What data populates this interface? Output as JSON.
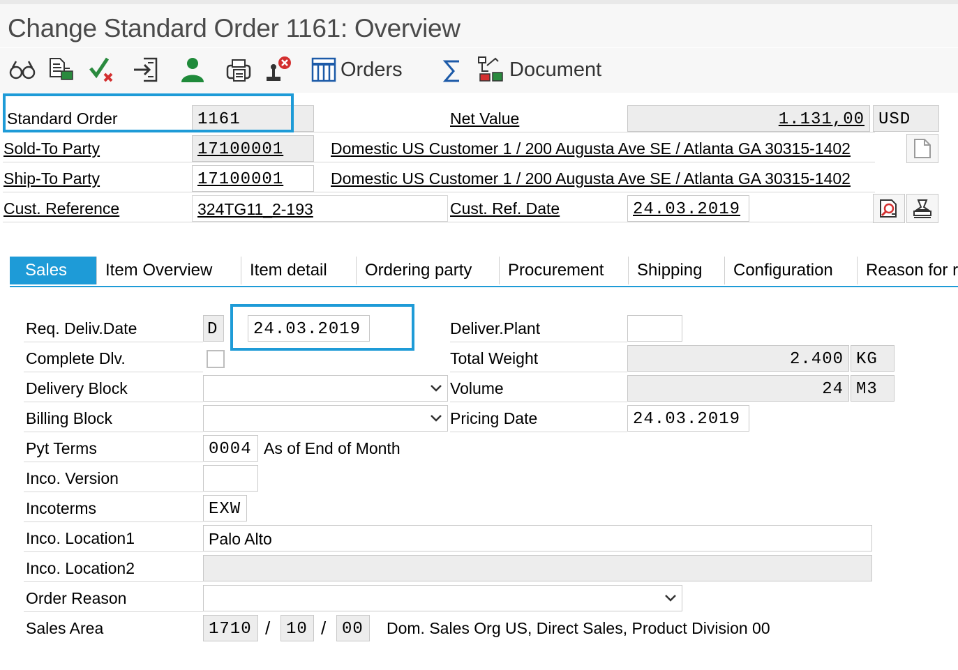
{
  "window": {
    "title": "Change Standard Order 1161: Overview"
  },
  "toolbar": {
    "icons": [
      "display-icon",
      "document-copy-icon",
      "check-icon",
      "exit-icon",
      "user-icon",
      "print-icon",
      "stop-icon",
      "grid-icon",
      "sum-icon",
      "document-tree-icon"
    ],
    "orders_label": "Orders",
    "document_label": "Document"
  },
  "header": {
    "standard_order_label": "Standard Order",
    "standard_order_value": "1161",
    "net_value_label": "Net Value",
    "net_value": "1.131,00",
    "currency": "USD",
    "sold_to_label": "Sold-To Party",
    "sold_to_value": "17100001",
    "sold_to_address": "Domestic US Customer 1 / 200 Augusta Ave SE / Atlanta GA 30315-1402",
    "ship_to_label": "Ship-To Party",
    "ship_to_value": "17100001",
    "ship_to_address": "Domestic US Customer 1 / 200 Augusta Ave SE / Atlanta GA 30315-1402",
    "cust_ref_label": "Cust. Reference",
    "cust_ref_value": "324TG11_2-193",
    "cust_ref_date_label": "Cust. Ref. Date",
    "cust_ref_date_value": "24.03.2019"
  },
  "tabs": [
    {
      "label": "Sales",
      "active": true
    },
    {
      "label": "Item Overview"
    },
    {
      "label": "Item detail"
    },
    {
      "label": "Ordering party"
    },
    {
      "label": "Procurement"
    },
    {
      "label": "Shipping"
    },
    {
      "label": "Configuration"
    },
    {
      "label": "Reason for r"
    }
  ],
  "sales": {
    "req_deliv_date_label": "Req. Deliv.Date",
    "req_deliv_date_format": "D",
    "req_deliv_date_value": "24.03.2019",
    "complete_dlv_label": "Complete Dlv.",
    "complete_dlv_checked": false,
    "delivery_block_label": "Delivery Block",
    "delivery_block_value": "",
    "billing_block_label": "Billing Block",
    "billing_block_value": "",
    "pyt_terms_label": "Pyt Terms",
    "pyt_terms_value": "0004",
    "pyt_terms_text": "As of End of Month",
    "inco_version_label": "Inco. Version",
    "inco_version_value": "",
    "incoterms_label": "Incoterms",
    "incoterms_value": "EXW",
    "inco_location1_label": "Inco. Location1",
    "inco_location1_value": "Palo Alto",
    "inco_location2_label": "Inco. Location2",
    "inco_location2_value": "",
    "order_reason_label": "Order Reason",
    "order_reason_value": "",
    "sales_area_label": "Sales Area",
    "sales_org": "1710",
    "dist_channel": "10",
    "division": "00",
    "sales_area_sep": "/",
    "sales_area_text": "Dom. Sales Org US, Direct Sales, Product Division 00",
    "deliver_plant_label": "Deliver.Plant",
    "deliver_plant_value": "",
    "total_weight_label": "Total Weight",
    "total_weight_value": "2.400",
    "weight_unit": "KG",
    "volume_label": "Volume",
    "volume_value": "24",
    "volume_unit": "M3",
    "pricing_date_label": "Pricing Date",
    "pricing_date_value": "24.03.2019"
  },
  "colors": {
    "accent": "#1e9bd7",
    "readonly_bg": "#ededed"
  }
}
